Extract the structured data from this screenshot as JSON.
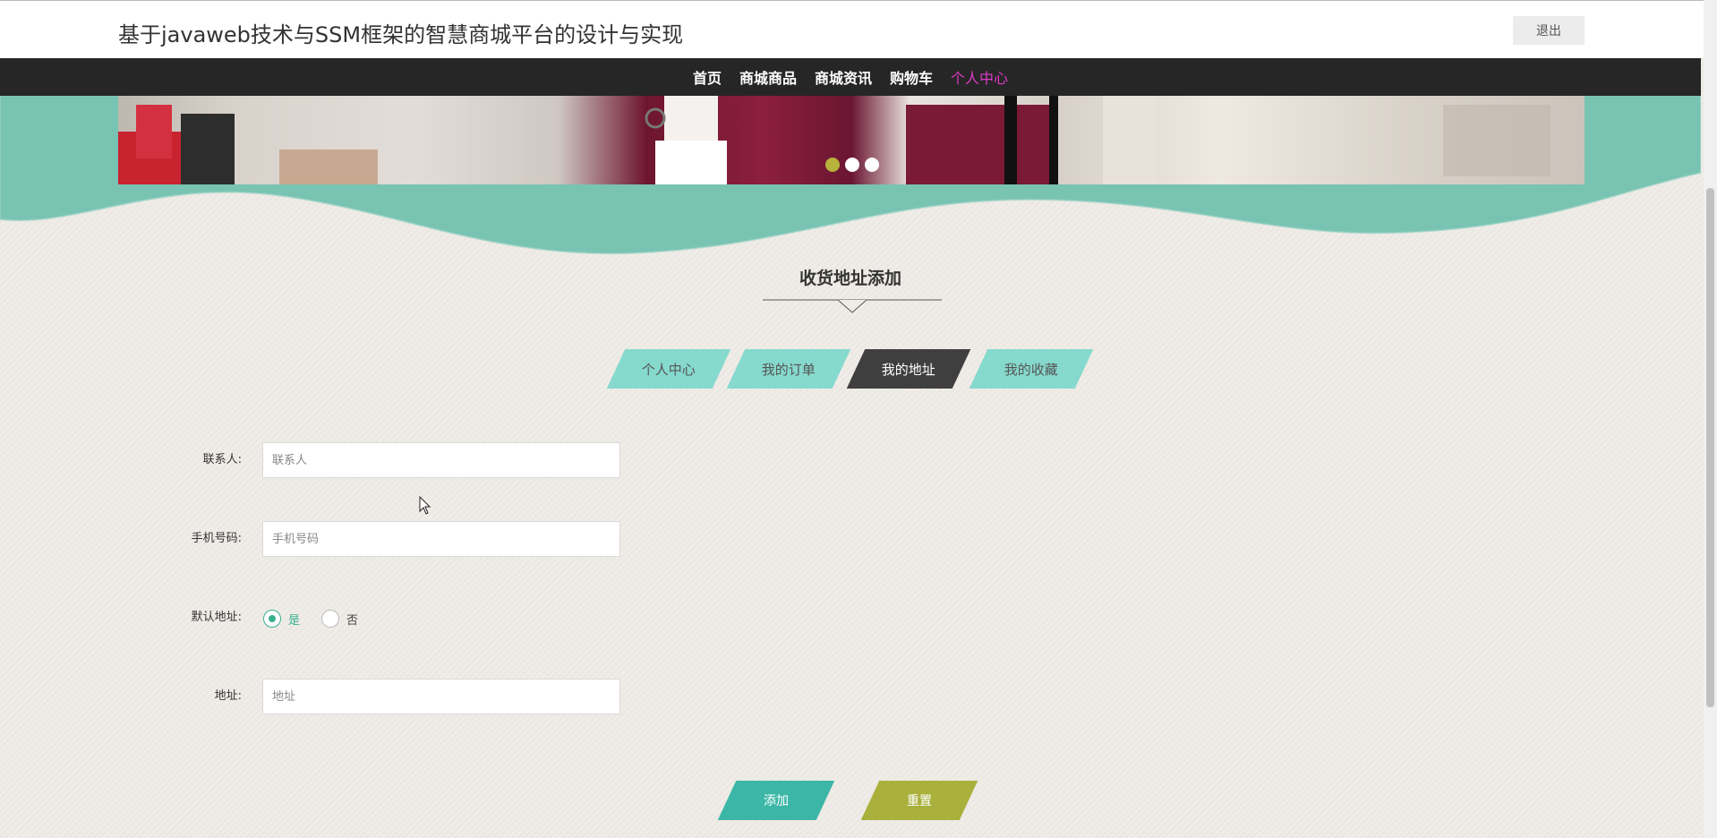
{
  "header": {
    "title": "基于javaweb技术与SSM框架的智慧商城平台的设计与实现",
    "logout_label": "退出"
  },
  "nav": {
    "items": [
      {
        "label": "首页",
        "active": false
      },
      {
        "label": "商城商品",
        "active": false
      },
      {
        "label": "商城资讯",
        "active": false
      },
      {
        "label": "购物车",
        "active": false
      },
      {
        "label": "个人中心",
        "active": true
      }
    ]
  },
  "carousel": {
    "slide_count": 3,
    "active_index": 0
  },
  "section": {
    "title": "收货地址添加"
  },
  "tabs": [
    {
      "label": "个人中心",
      "active": false
    },
    {
      "label": "我的订单",
      "active": false
    },
    {
      "label": "我的地址",
      "active": true
    },
    {
      "label": "我的收藏",
      "active": false
    }
  ],
  "form": {
    "contact": {
      "label": "联系人:",
      "placeholder": "联系人",
      "value": ""
    },
    "phone": {
      "label": "手机号码:",
      "placeholder": "手机号码",
      "value": ""
    },
    "default_address": {
      "label": "默认地址:",
      "options": [
        {
          "label": "是",
          "checked": true
        },
        {
          "label": "否",
          "checked": false
        }
      ]
    },
    "address": {
      "label": "地址:",
      "placeholder": "地址",
      "value": ""
    }
  },
  "buttons": {
    "add_label": "添加",
    "reset_label": "重置"
  },
  "colors": {
    "teal": "#79c3b2",
    "nav_bg": "#262626",
    "nav_active": "#e03ac8",
    "tab_bg": "#86d9cd",
    "tab_active_bg": "#3f3f3f",
    "add_button": "#3cb7a7",
    "reset_button": "#a9b03c",
    "dot_active": "#b7b33c",
    "radio_checked": "#38b08e"
  }
}
